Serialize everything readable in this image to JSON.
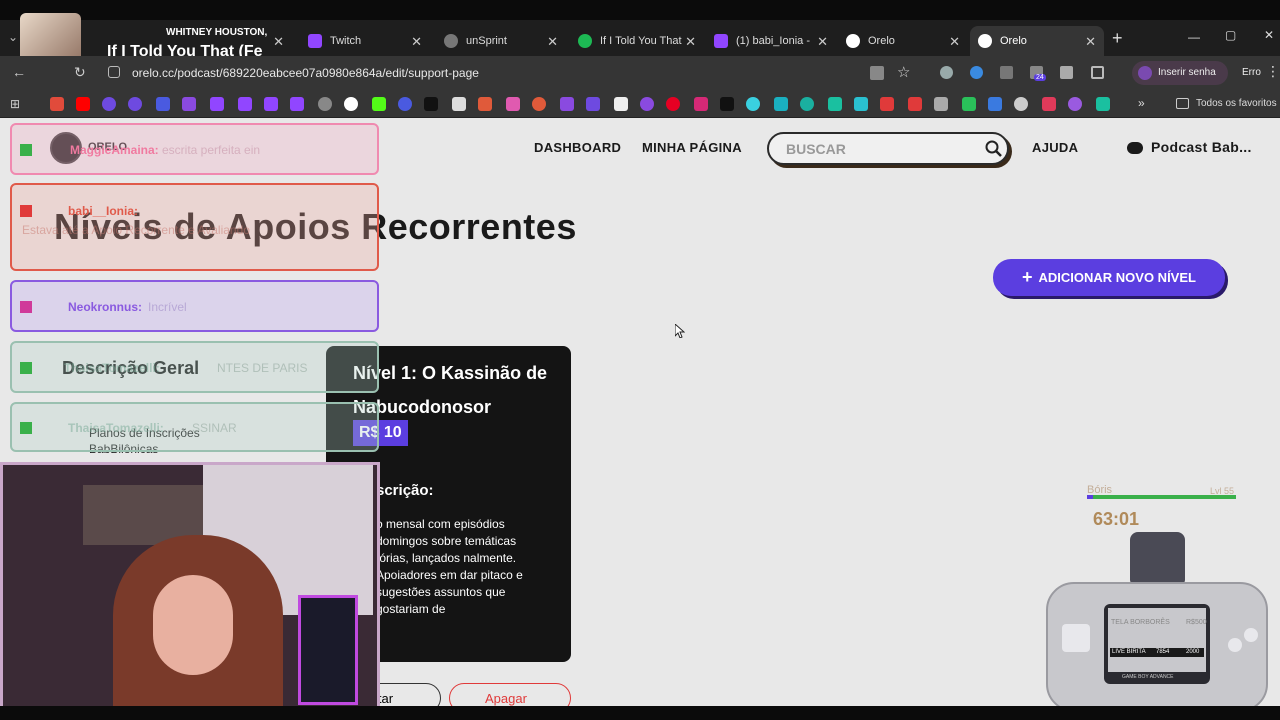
{
  "browser": {
    "tabs": [
      {
        "label": "WHITNEY HOUSTON,",
        "icon": "album-art-icon"
      },
      {
        "label": "Twitch",
        "icon": "twitch-icon",
        "color": "#9146ff"
      },
      {
        "label": "unSprint",
        "icon": "globe-icon",
        "color": "#aaaaaa"
      },
      {
        "label": "If I Told You That",
        "icon": "spotify-icon",
        "color": "#1db954"
      },
      {
        "label": "(1) babi_Ionia -",
        "icon": "twitch-icon",
        "color": "#9146ff"
      },
      {
        "label": "Orelo",
        "icon": "orelo-icon",
        "color": "#ffffff"
      },
      {
        "label": "Orelo",
        "icon": "orelo-icon",
        "color": "#ffffff"
      }
    ],
    "media_overlay": {
      "artist": "WHITNEY HOUSTON,",
      "song": "If I Told You That (Fe"
    },
    "new_tab": "+",
    "url": "orelo.cc/podcast/689220eabcee07a0980e864a/edit/support-page",
    "profile_label": "Inserir senha",
    "error_label": "Erro",
    "bookmarks_more": "»",
    "favorites_label": "Todos os favoritos",
    "window_controls": [
      "—",
      "▢",
      "✕"
    ],
    "ext_badge": "24"
  },
  "site": {
    "logo": "ORELO",
    "nav": {
      "dashboard": "DASHBOARD",
      "my_page": "MINHA PÁGINA",
      "help": "AJUDA",
      "podcast": "Podcast Bab..."
    },
    "search": {
      "placeholder": "BUSCAR"
    },
    "title": "Níveis de Apoios Recorrentes",
    "add_button": "ADICIONAR NOVO NÍVEL",
    "section_title": "Descrição Geral",
    "section_text": "Planos de Inscrições BabBilônicas",
    "card": {
      "title": "Nível 1: O Kassinão de Nabucodonosor",
      "price": "R$ 10",
      "desc_heading": "scrição:",
      "desc_text": "o mensal com episódios domingos sobre temáticas tórias, lançados nalmente. Apoiadores em dar pitaco e sugestões assuntos que gostariam de"
    },
    "actions": {
      "edit": "itar",
      "delete": "Apagar"
    }
  },
  "chat": [
    {
      "user": "MaggieAmaina:",
      "text": "escrita perfeita ein"
    },
    {
      "user": "babi__Ionia:",
      "text": "Estava até a Apoio Recorrente e Avaliando"
    },
    {
      "user": "Neokronnus:",
      "text": "Incrível"
    },
    {
      "user": "ThaisaTomazelli:",
      "text": "NTES DE PARIS"
    },
    {
      "user": "ThaisaTomazelli:",
      "text": "SSINAR"
    }
  ],
  "overlay_game": {
    "pet_name": "Bóris",
    "level": "Lvl 55",
    "timer": "63:01",
    "screen_line1": "TELA BORBORÊS",
    "screen_line1_val": "R$500",
    "screen_line2": "LIVE BIRITA",
    "screen_line2_val": "7854",
    "screen_line2_max": "2000",
    "brand": "GAME BOY ADVANCE"
  }
}
